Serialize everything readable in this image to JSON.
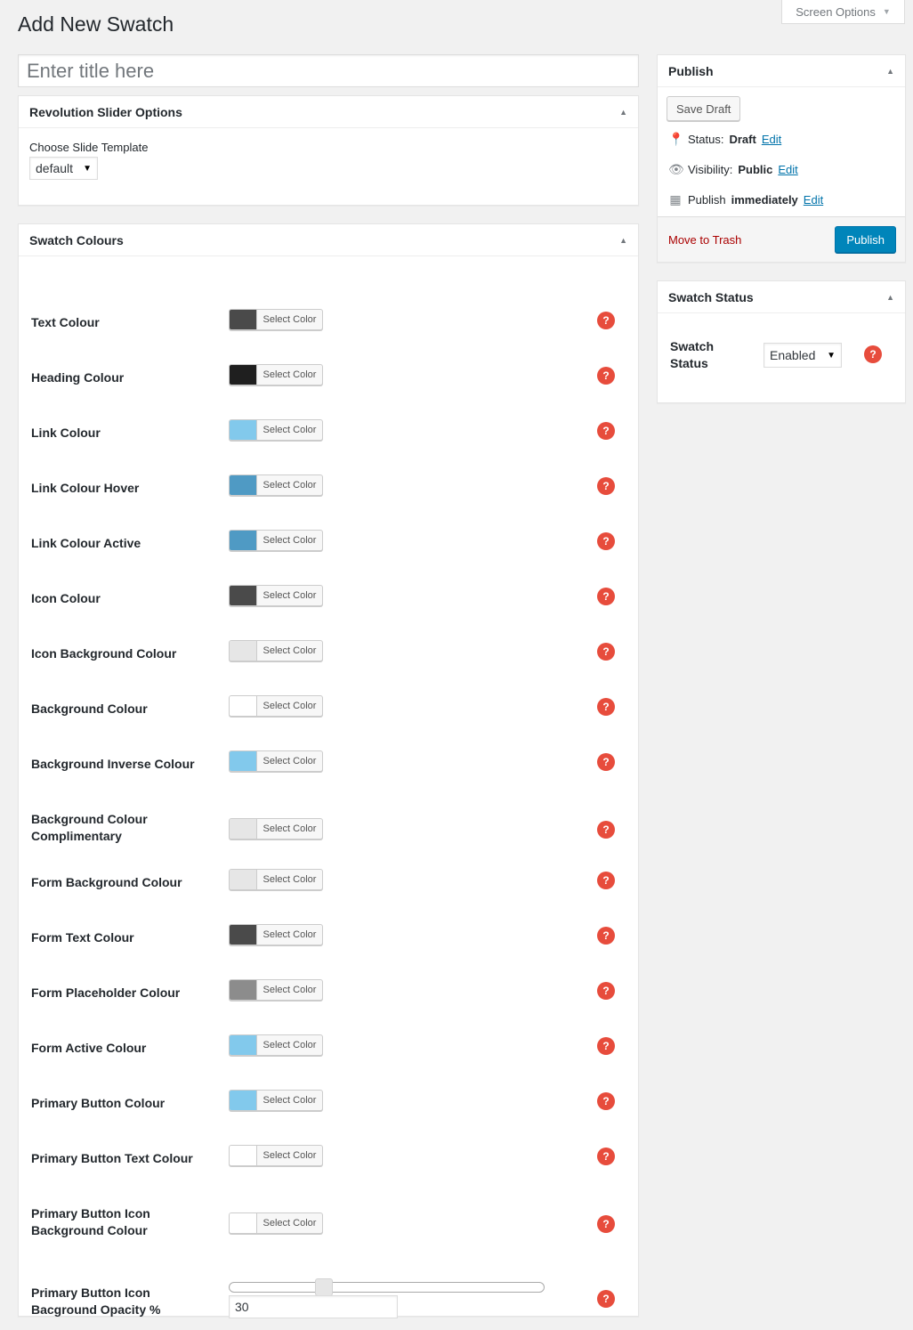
{
  "screen_options": {
    "label": "Screen Options"
  },
  "page": {
    "title": "Add New Swatch"
  },
  "title_field": {
    "placeholder": "Enter title here",
    "value": ""
  },
  "revslider": {
    "title": "Revolution Slider Options",
    "template_label": "Choose Slide Template",
    "template_value": "default"
  },
  "swatch_colours": {
    "title": "Swatch Colours",
    "select_label": "Select Color",
    "rows": [
      {
        "label": "Text Colour",
        "color": "#4a4a4a"
      },
      {
        "label": "Heading Colour",
        "color": "#1f1f1f"
      },
      {
        "label": "Link Colour",
        "color": "#82c9ec"
      },
      {
        "label": "Link Colour Hover",
        "color": "#4f9ac4"
      },
      {
        "label": "Link Colour Active",
        "color": "#4f9ac4"
      },
      {
        "label": "Icon Colour",
        "color": "#4a4a4a"
      },
      {
        "label": "Icon Background Colour",
        "color": "#e6e6e6"
      },
      {
        "label": "Background Colour",
        "color": "#ffffff"
      },
      {
        "label": "Background Inverse Colour",
        "color": "#82c9ec"
      },
      {
        "label": "Background Colour Complimentary",
        "color": "#e6e6e6"
      },
      {
        "label": "Form Background Colour",
        "color": "#e6e6e6"
      },
      {
        "label": "Form Text Colour",
        "color": "#4a4a4a"
      },
      {
        "label": "Form Placeholder Colour",
        "color": "#8c8c8c"
      },
      {
        "label": "Form Active Colour",
        "color": "#82c9ec"
      },
      {
        "label": "Primary Button Colour",
        "color": "#82c9ec"
      },
      {
        "label": "Primary Button Text Colour",
        "color": "#ffffff"
      },
      {
        "label": "Primary Button Icon Background Colour",
        "color": "#ffffff"
      }
    ],
    "opacity": {
      "label": "Primary Button Icon Bacground Opacity %",
      "value": "30",
      "slider_fraction": 0.3
    }
  },
  "publish": {
    "title": "Publish",
    "save_draft": "Save Draft",
    "status_label": "Status:",
    "status_value": "Draft",
    "visibility_label": "Visibility:",
    "visibility_value": "Public",
    "publish_label": "Publish",
    "publish_value": "immediately",
    "edit": "Edit",
    "trash": "Move to Trash",
    "publish_button": "Publish"
  },
  "swatch_status": {
    "title": "Swatch Status",
    "label": "Swatch Status",
    "value": "Enabled"
  },
  "colors": {
    "accent": "#0085ba",
    "help": "#e74c3c",
    "trash": "#aa0000",
    "link": "#0073aa"
  },
  "help_icon": "?"
}
